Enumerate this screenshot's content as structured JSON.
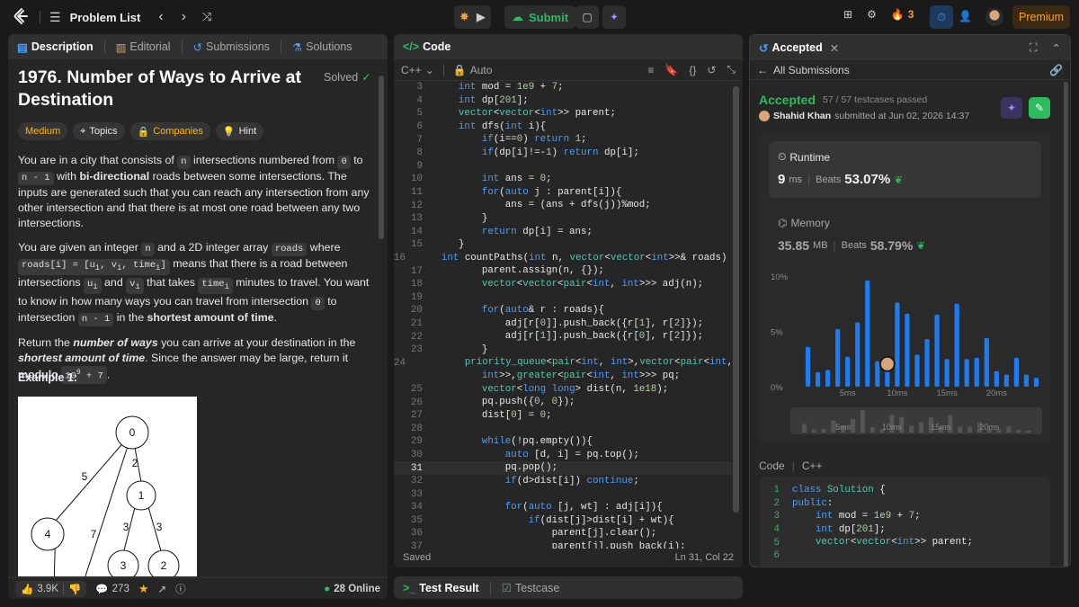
{
  "topbar": {
    "problem_list": "Problem List",
    "submit": "Submit",
    "streak": "3",
    "premium": "Premium"
  },
  "left": {
    "tabs": [
      "Description",
      "Editorial",
      "Submissions",
      "Solutions"
    ],
    "title": "1976. Number of Ways to Arrive at Destination",
    "solved": "Solved",
    "tags": [
      "Medium",
      "Topics",
      "Companies",
      "Hint"
    ],
    "p1": [
      "You are in a city that consists of ",
      "n",
      " intersections numbered from ",
      "0",
      " to ",
      "n - 1",
      " with ",
      "bi-directional",
      " roads between some intersections. The inputs are generated such that you can reach any intersection from any other intersection and that there is at most one road between any two intersections."
    ],
    "p2": [
      "You are given an integer ",
      "n",
      " and a 2D integer array ",
      "roads",
      " where ",
      "roads[i] = [u",
      "i",
      ", v",
      "i",
      ", time",
      "i",
      "]",
      " means that there is a road between intersections ",
      "u",
      "i",
      " and ",
      "v",
      "i",
      " that takes ",
      "time",
      "i",
      " minutes to travel. You want to know in how many ways you can travel from intersection ",
      "0",
      " to intersection ",
      "n - 1",
      " in the ",
      "shortest amount of time",
      "."
    ],
    "p3": [
      "Return the ",
      "number of ways",
      " you can arrive at your destination in the ",
      "shortest amount of time",
      ". Since the answer may be large, return it ",
      "modulo",
      " ",
      "10",
      "9",
      " + 7",
      "."
    ],
    "example": "Example 1:",
    "graph": {
      "nodes": [
        "0",
        "1",
        "4",
        "3",
        "2"
      ],
      "edges": [
        "5",
        "2",
        "7",
        "3",
        "3"
      ]
    },
    "footer": {
      "likes": "3.9K",
      "comments": "273",
      "online": "28 Online"
    }
  },
  "code": {
    "tab": "Code",
    "lang": "C++",
    "auto": "Auto",
    "status": "Saved",
    "cursor": "Ln 31, Col 22",
    "lines": [
      {
        "n": "3",
        "t": "    int mod = 1e9 + 7;"
      },
      {
        "n": "4",
        "t": "    int dp[201];"
      },
      {
        "n": "5",
        "t": "    vector<vector<int>> parent;"
      },
      {
        "n": "6",
        "t": "    int dfs(int i){"
      },
      {
        "n": "7",
        "t": "        if(i==0) return 1;"
      },
      {
        "n": "8",
        "t": "        if(dp[i]!=-1) return dp[i];"
      },
      {
        "n": "9",
        "t": ""
      },
      {
        "n": "10",
        "t": "        int ans = 0;"
      },
      {
        "n": "11",
        "t": "        for(auto j : parent[i]){"
      },
      {
        "n": "12",
        "t": "            ans = (ans + dfs(j))%mod;"
      },
      {
        "n": "13",
        "t": "        }"
      },
      {
        "n": "14",
        "t": "        return dp[i] = ans;"
      },
      {
        "n": "15",
        "t": "    }"
      },
      {
        "n": "16",
        "t": "    int countPaths(int n, vector<vector<int>>& roads) {"
      },
      {
        "n": "17",
        "t": "        parent.assign(n, {});"
      },
      {
        "n": "18",
        "t": "        vector<vector<pair<int, int>>> adj(n);"
      },
      {
        "n": "19",
        "t": ""
      },
      {
        "n": "20",
        "t": "        for(auto& r : roads){"
      },
      {
        "n": "21",
        "t": "            adj[r[0]].push_back({r[1], r[2]});"
      },
      {
        "n": "22",
        "t": "            adj[r[1]].push_back({r[0], r[2]});"
      },
      {
        "n": "23",
        "t": "        }"
      },
      {
        "n": "24",
        "t": "        priority_queue<pair<int, int>,vector<pair<int,"
      },
      {
        "n": "",
        "t": "        int>>,greater<pair<int, int>>> pq;"
      },
      {
        "n": "25",
        "t": "        vector<long long> dist(n, 1e18);"
      },
      {
        "n": "26",
        "t": "        pq.push({0, 0});"
      },
      {
        "n": "27",
        "t": "        dist[0] = 0;"
      },
      {
        "n": "28",
        "t": ""
      },
      {
        "n": "29",
        "t": "        while(!pq.empty()){"
      },
      {
        "n": "30",
        "t": "            auto [d, i] = pq.top();"
      },
      {
        "n": "31",
        "t": "            pq.pop();"
      },
      {
        "n": "32",
        "t": "            if(d>dist[i]) continue;"
      },
      {
        "n": "33",
        "t": ""
      },
      {
        "n": "34",
        "t": "            for(auto [j, wt] : adj[i]){"
      },
      {
        "n": "35",
        "t": "                if(dist[j]>dist[i] + wt){"
      },
      {
        "n": "36",
        "t": "                    parent[j].clear();"
      },
      {
        "n": "37",
        "t": "                    parent[j].push_back(i);"
      }
    ]
  },
  "bottom": {
    "test_result": "Test Result",
    "testcase": "Testcase"
  },
  "right": {
    "tab": "Accepted",
    "all_submissions": "All Submissions",
    "status": "Accepted",
    "passed": "57 / 57 testcases passed",
    "user": "Shahid Khan",
    "submitted": "submitted at Jun 02, 2026 14:37",
    "runtime_label": "Runtime",
    "runtime_value": "9",
    "runtime_unit": "ms",
    "runtime_beats_label": "Beats",
    "runtime_beats": "53.07%",
    "memory_label": "Memory",
    "memory_value": "35.85",
    "memory_unit": "MB",
    "memory_beats_label": "Beats",
    "memory_beats": "58.79%",
    "code_label": "Code",
    "code_lang": "C++",
    "code_lines": [
      {
        "n": "1",
        "t": "class Solution {"
      },
      {
        "n": "2",
        "t": "public:"
      },
      {
        "n": "3",
        "t": "    int mod = 1e9 + 7;"
      },
      {
        "n": "4",
        "t": "    int dp[201];"
      },
      {
        "n": "5",
        "t": "    vector<vector<int>> parent;"
      },
      {
        "n": "6",
        "t": ""
      }
    ]
  },
  "chart_data": {
    "type": "bar",
    "ylabels": [
      "10%",
      "5%",
      "0%"
    ],
    "ylim": [
      0,
      10
    ],
    "xlabels": [
      "5ms",
      "10ms",
      "15ms",
      "20ms"
    ],
    "xlabel_positions": [
      5,
      10,
      15,
      20
    ],
    "x": [
      1,
      2,
      3,
      4,
      5,
      6,
      7,
      8,
      9,
      10,
      11,
      12,
      13,
      14,
      15,
      16,
      17,
      18,
      19,
      20,
      21,
      22,
      23,
      24
    ],
    "values": [
      3.6,
      1.3,
      1.5,
      5.2,
      2.7,
      5.8,
      9.6,
      2.3,
      1.4,
      7.6,
      6.6,
      2.9,
      4.3,
      6.5,
      2.5,
      7.5,
      2.5,
      2.6,
      4.4,
      1.4,
      1.1,
      2.6,
      1.1,
      0.8
    ],
    "highlight_x": 9
  }
}
